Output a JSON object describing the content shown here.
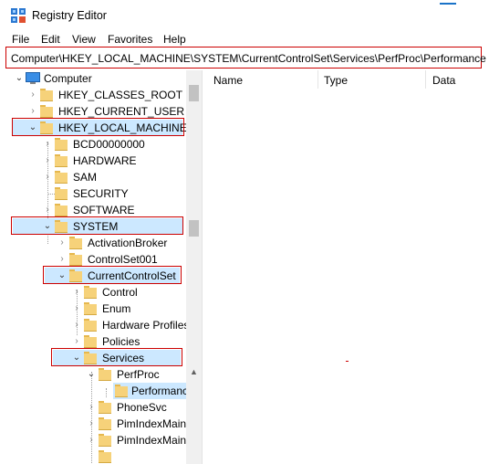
{
  "window": {
    "title": "Registry Editor"
  },
  "menu": [
    "File",
    "Edit",
    "View",
    "Favorites",
    "Help"
  ],
  "address": {
    "path": "Computer\\HKEY_LOCAL_MACHINE\\SYSTEM\\CurrentControlSet\\Services\\PerfProc\\Performance"
  },
  "tree": [
    {
      "label": "Computer",
      "icon": "computer-icon",
      "expanded": true
    },
    {
      "label": "HKEY_CLASSES_ROOT",
      "icon": "folder-icon"
    },
    {
      "label": "HKEY_CURRENT_USER",
      "icon": "folder-icon"
    },
    {
      "label": "HKEY_LOCAL_MACHINE",
      "icon": "folder-icon",
      "expanded": true
    },
    {
      "label": "BCD00000000",
      "icon": "folder-icon"
    },
    {
      "label": "HARDWARE",
      "icon": "folder-icon"
    },
    {
      "label": "SAM",
      "icon": "folder-icon"
    },
    {
      "label": "SECURITY",
      "icon": "folder-icon"
    },
    {
      "label": "SOFTWARE",
      "icon": "folder-icon"
    },
    {
      "label": "SYSTEM",
      "icon": "folder-icon",
      "expanded": true
    },
    {
      "label": "ActivationBroker",
      "icon": "folder-icon"
    },
    {
      "label": "ControlSet001",
      "icon": "folder-icon"
    },
    {
      "label": "CurrentControlSet",
      "icon": "folder-icon",
      "expanded": true
    },
    {
      "label": "Control",
      "icon": "folder-icon"
    },
    {
      "label": "Enum",
      "icon": "folder-icon"
    },
    {
      "label": "Hardware Profiles",
      "icon": "folder-icon"
    },
    {
      "label": "Policies",
      "icon": "folder-icon"
    },
    {
      "label": "Services",
      "icon": "folder-icon",
      "expanded": true
    },
    {
      "label": "PerfProc",
      "icon": "folder-icon",
      "expanded": true
    },
    {
      "label": "Performance",
      "icon": "folder-icon",
      "selected": true
    },
    {
      "label": "PhoneSvc",
      "icon": "folder-icon"
    },
    {
      "label": "PimIndexMain",
      "icon": "folder-icon"
    },
    {
      "label": "PimIndexMain",
      "icon": "folder-icon"
    }
  ],
  "columns": [
    "Name",
    "Type",
    "Data"
  ],
  "colors": {
    "highlight_border": "#cc0000",
    "selection": "#cce8ff",
    "folder": "#f6d27a"
  }
}
